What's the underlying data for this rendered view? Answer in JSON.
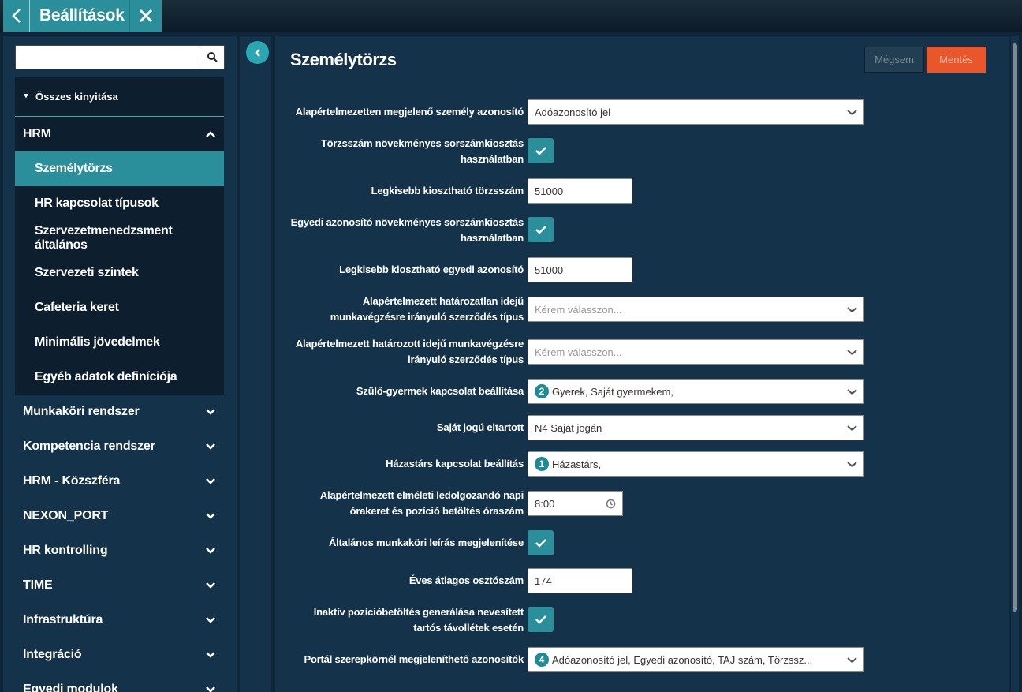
{
  "tab": {
    "title": "Beállítások"
  },
  "sidebar": {
    "expand_all": "Összes kinyitása",
    "hrm": "HRM",
    "sub_items": [
      "Személytörzs",
      "HR kapcsolat típusok",
      "Szervezetmenedzsment általános",
      "Szervezeti szintek",
      "Cafeteria keret",
      "Minimális jövedelmek",
      "Egyéb adatok definíciója"
    ],
    "groups": [
      "Munkaköri rendszer",
      "Kompetencia rendszer",
      "HRM - Közszféra",
      "NEXON_PORT",
      "HR kontrolling",
      "TIME",
      "Infrastruktúra",
      "Integráció",
      "Egyedi modulok"
    ]
  },
  "main": {
    "title": "Személytörzs",
    "cancel": "Mégsem",
    "save": "Mentés",
    "rows": {
      "r1": {
        "label": "Alapértelmezetten megjelenő személy azonosító",
        "value": "Adóazonosító jel"
      },
      "r2": {
        "label1": "Törzsszám növekményes sorszámkiosztás",
        "label2": "használatban"
      },
      "r3": {
        "label": "Legkisebb kiosztható törzsszám",
        "value": "51000"
      },
      "r4": {
        "label1": "Egyedi azonosító növekményes sorszámkiosztás",
        "label2": "használatban"
      },
      "r5": {
        "label": "Legkisebb kiosztható egyedi azonosító",
        "value": "51000"
      },
      "r6": {
        "label1": "Alapértelmezett határozatlan idejű",
        "label2": "munkavégzésre irányuló szerződés típus",
        "placeholder": "Kérem válasszon..."
      },
      "r7": {
        "label1": "Alapértelmezett határozott idejű munkavégzésre",
        "label2": "irányuló szerződés típus",
        "placeholder": "Kérem válasszon..."
      },
      "r8": {
        "label": "Szülő-gyermek kapcsolat beállítása",
        "badge": "2",
        "value": "Gyerek, Saját gyermekem,"
      },
      "r9": {
        "label": "Saját jogú eltartott",
        "value": "N4 Saját jogán"
      },
      "r10": {
        "label": "Házastárs kapcsolat beállítás",
        "badge": "1",
        "value": "Házastárs,"
      },
      "r11": {
        "label1": "Alapértelmezett elméleti ledolgozandó napi",
        "label2": "órakeret és pozíció betöltés óraszám",
        "value": "8:00"
      },
      "r12": {
        "label": "Általános munkaköri leírás megjelenítése"
      },
      "r13": {
        "label": "Éves átlagos osztószám",
        "value": "174"
      },
      "r14": {
        "label1": "Inaktív pozícióbetöltés generálása nevesített",
        "label2": "tartós távollétek esetén"
      },
      "r15": {
        "label": "Portál szerepkörnél megjeleníthető azonosítók",
        "badge": "4",
        "value": "Adóazonosító jel, Egyedi azonosító, TAJ szám, Törzssz..."
      }
    }
  },
  "colors": {
    "accent": "#2a8f9a",
    "save": "#e8562a",
    "panel": "#14334a"
  }
}
